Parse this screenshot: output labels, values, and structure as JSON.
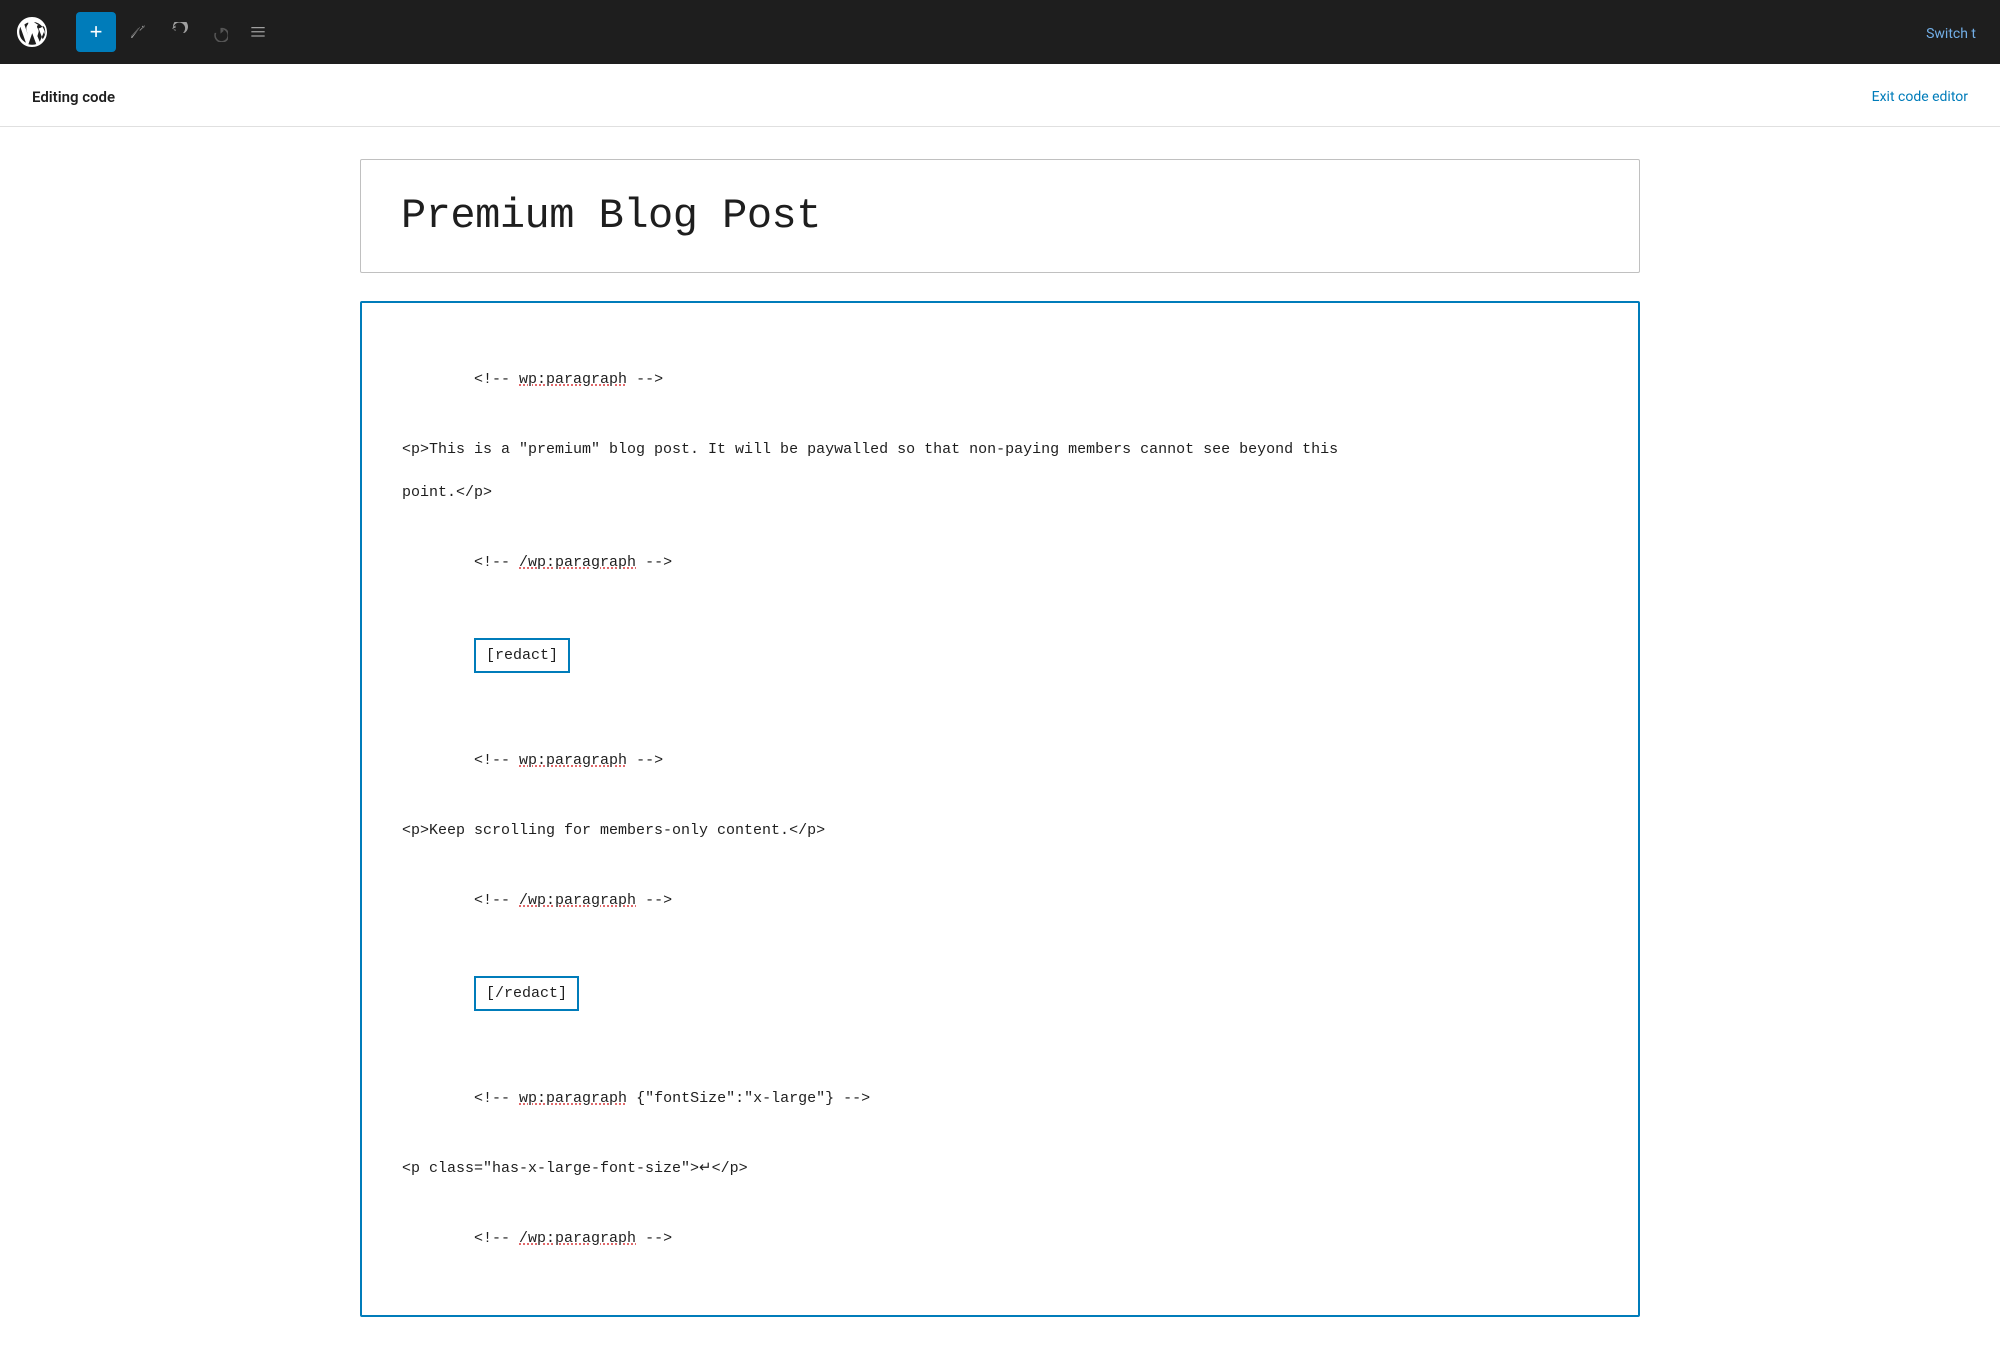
{
  "toolbar": {
    "add_label": "+",
    "switch_label": "Switch t",
    "switch_full": "Switch to"
  },
  "sub_header": {
    "editing_code_label": "Editing code",
    "exit_link_label": "Exit code editor"
  },
  "title_block": {
    "post_title": "Premium Blog Post"
  },
  "code_editor": {
    "lines": [
      {
        "type": "comment",
        "text": "<!-- wp:paragraph -->"
      },
      {
        "type": "empty"
      },
      {
        "type": "code",
        "text": "<p>This is a \"premium\" blog post. It will be paywalled so that non-paying members cannot see beyond this"
      },
      {
        "type": "empty"
      },
      {
        "type": "code",
        "text": "point.</p>"
      },
      {
        "type": "empty"
      },
      {
        "type": "comment",
        "text": "<!-- /wp:paragraph -->"
      },
      {
        "type": "shortcode",
        "text": "[redact]"
      },
      {
        "type": "empty"
      },
      {
        "type": "comment",
        "text": "<!-- wp:paragraph -->"
      },
      {
        "type": "empty"
      },
      {
        "type": "code",
        "text": "<p>Keep scrolling for members-only content.</p>"
      },
      {
        "type": "empty"
      },
      {
        "type": "comment",
        "text": "<!-- /wp:paragraph -->"
      },
      {
        "type": "shortcode",
        "text": "[/redact]"
      },
      {
        "type": "empty"
      },
      {
        "type": "comment",
        "text": "<!-- wp:paragraph {\"fontSize\":\"x-large\"} -->"
      },
      {
        "type": "empty"
      },
      {
        "type": "code",
        "text": "<p class=\"has-x-large-font-size\">↵</p>"
      },
      {
        "type": "empty"
      },
      {
        "type": "comment",
        "text": "<!-- /wp:paragraph -->"
      }
    ]
  },
  "icons": {
    "add": "+",
    "pen": "✎",
    "undo": "↩",
    "redo": "↪",
    "list": "≡"
  }
}
